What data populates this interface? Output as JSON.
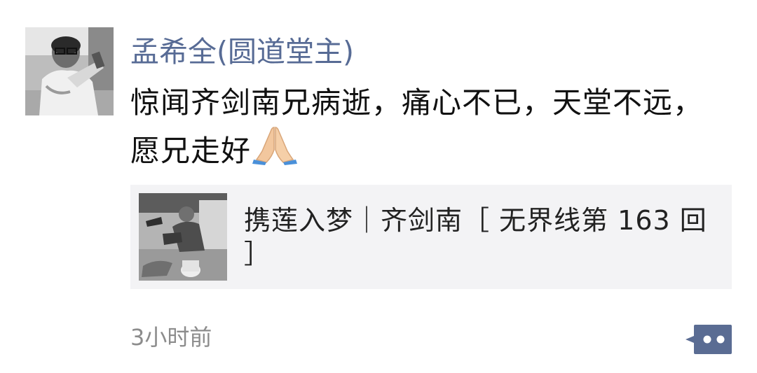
{
  "post": {
    "author": "孟希全(圆道堂主)",
    "text": "惊闻齐剑南兄病逝，痛心不已，天堂不远，愿兄走好",
    "emoji": "folded-hands-emoji",
    "timestamp": "3小时前"
  },
  "link_card": {
    "title": "携莲入梦｜齐剑南［ 无界线第 163 回 ］",
    "thumbnail": "grayscale-photo-man-crouching-with-bucket"
  },
  "avatar": {
    "image": "grayscale-photo-man-with-glasses"
  },
  "actions": {
    "comment_icon": "comment-dots-icon"
  },
  "colors": {
    "author_name": "#576b95",
    "body_text": "#111111",
    "card_background": "#f3f3f5",
    "timestamp": "#8c8c8c",
    "comment_button": "#5a6c93"
  }
}
